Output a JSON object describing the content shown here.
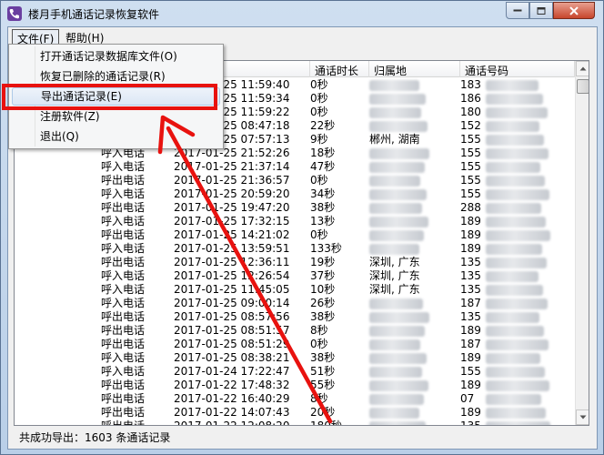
{
  "window": {
    "title": "楼月手机通话记录恢复软件"
  },
  "menubar": {
    "file": "文件(F)",
    "help": "帮助(H)"
  },
  "file_menu": {
    "items": [
      {
        "label": "打开通话记录数据库文件(O)"
      },
      {
        "label": "恢复已删除的通话记录(R)"
      },
      {
        "label": "导出通话记录(E)"
      },
      {
        "label": "注册软件(Z)"
      },
      {
        "label": "退出(Q)"
      }
    ]
  },
  "table": {
    "columns": {
      "duration": "通话时长",
      "location": "归属地",
      "number": "通话号码"
    },
    "rows": [
      {
        "type": "",
        "time": "2017-01-25 11:59:40",
        "duration": "0秒",
        "location": "",
        "number": "183"
      },
      {
        "type": "",
        "time": "2017-01-25 11:59:34",
        "duration": "0秒",
        "location": "",
        "number": "186"
      },
      {
        "type": "",
        "time": "2017-01-25 11:59:22",
        "duration": "0秒",
        "location": "",
        "number": "180"
      },
      {
        "type": "",
        "time": "2017-01-25 08:47:18",
        "duration": "22秒",
        "location": "",
        "number": "152"
      },
      {
        "type": "",
        "time": "2017-01-25 07:57:13",
        "duration": "9秒",
        "location": "郴州, 湖南",
        "number": "155"
      },
      {
        "type": "呼入电话",
        "time": "2017-01-25 21:52:26",
        "duration": "18秒",
        "location": "",
        "number": "155"
      },
      {
        "type": "呼入电话",
        "time": "2017-01-25 21:37:14",
        "duration": "47秒",
        "location": "",
        "number": "155"
      },
      {
        "type": "呼出电话",
        "time": "2017-01-25 21:36:57",
        "duration": "0秒",
        "location": "",
        "number": "155"
      },
      {
        "type": "呼入电话",
        "time": "2017-01-25 20:59:20",
        "duration": "34秒",
        "location": "",
        "number": "155"
      },
      {
        "type": "呼出电话",
        "time": "2017-01-25 19:47:20",
        "duration": "38秒",
        "location": "",
        "number": "288"
      },
      {
        "type": "呼入电话",
        "time": "2017-01-25 17:32:15",
        "duration": "13秒",
        "location": "",
        "number": "189"
      },
      {
        "type": "呼出电话",
        "time": "2017-01-25 14:21:02",
        "duration": "0秒",
        "location": "",
        "number": "189"
      },
      {
        "type": "呼入电话",
        "time": "2017-01-25 13:59:51",
        "duration": "133秒",
        "location": "",
        "number": "189"
      },
      {
        "type": "呼出电话",
        "time": "2017-01-25 12:36:11",
        "duration": "19秒",
        "location": "深圳, 广东",
        "number": "135"
      },
      {
        "type": "呼入电话",
        "time": "2017-01-25 12:26:54",
        "duration": "37秒",
        "location": "深圳, 广东",
        "number": "135"
      },
      {
        "type": "呼入电话",
        "time": "2017-01-25 11:45:05",
        "duration": "10秒",
        "location": "深圳, 广东",
        "number": "135"
      },
      {
        "type": "呼入电话",
        "time": "2017-01-25 09:00:14",
        "duration": "26秒",
        "location": "",
        "number": "187"
      },
      {
        "type": "呼出电话",
        "time": "2017-01-25 08:57:56",
        "duration": "38秒",
        "location": "",
        "number": "135"
      },
      {
        "type": "呼出电话",
        "time": "2017-01-25 08:51:57",
        "duration": "8秒",
        "location": "",
        "number": "189"
      },
      {
        "type": "呼出电话",
        "time": "2017-01-25 08:51:29",
        "duration": "0秒",
        "location": "",
        "number": "187"
      },
      {
        "type": "呼入电话",
        "time": "2017-01-25 08:38:21",
        "duration": "38秒",
        "location": "",
        "number": "189"
      },
      {
        "type": "呼入电话",
        "time": "2017-01-24 17:22:47",
        "duration": "51秒",
        "location": "",
        "number": "155"
      },
      {
        "type": "呼出电话",
        "time": "2017-01-22 17:48:32",
        "duration": "55秒",
        "location": "",
        "number": "189"
      },
      {
        "type": "呼出电话",
        "time": "2017-01-22 16:40:29",
        "duration": "8秒",
        "location": "",
        "number": "07"
      },
      {
        "type": "呼出电话",
        "time": "2017-01-22 14:07:43",
        "duration": "20秒",
        "location": "",
        "number": "189"
      },
      {
        "type": "呼出电话",
        "time": "2017-01-22 12:08:20",
        "duration": "180秒",
        "location": "",
        "number": "135"
      }
    ]
  },
  "status": {
    "text": "共成功导出：1603 条通话记录"
  },
  "colors": {
    "annotation_red": "#e8120f",
    "title_bar": "#c4d7ee"
  }
}
